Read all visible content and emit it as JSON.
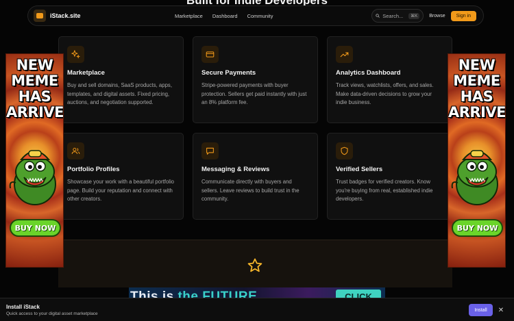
{
  "section": {
    "heading": "Built for Indie Developers"
  },
  "navbar": {
    "brand": "iStack.site",
    "links": [
      "Marketplace",
      "Dashboard",
      "Community"
    ],
    "search_placeholder": "Search...",
    "search_shortcut": "⌘K",
    "browse_label": "Browse",
    "signin_label": "Sign in"
  },
  "features": [
    {
      "icon": "sparkles-icon",
      "title": "Marketplace",
      "description": "Buy and sell domains, SaaS products, apps, templates, and digital assets. Fixed pricing, auctions, and negotiation supported."
    },
    {
      "icon": "credit-card-icon",
      "title": "Secure Payments",
      "description": "Stripe-powered payments with buyer protection. Sellers get paid instantly with just an 8% platform fee."
    },
    {
      "icon": "trending-up-icon",
      "title": "Analytics Dashboard",
      "description": "Track views, watchlists, offers, and sales. Make data-driven decisions to grow your indie business."
    },
    {
      "icon": "users-icon",
      "title": "Portfolio Profiles",
      "description": "Showcase your work with a beautiful portfolio page. Build your reputation and connect with other creators."
    },
    {
      "icon": "message-square-icon",
      "title": "Messaging & Reviews",
      "description": "Communicate directly with buyers and sellers. Leave reviews to build trust in the community."
    },
    {
      "icon": "shield-icon",
      "title": "Verified Sellers",
      "description": "Trust badges for verified creators. Know you're buying from real, established indie developers."
    }
  ],
  "side_ad": {
    "headline_lines": [
      "NEW",
      "MEME",
      "HAS",
      "ARRIVED!"
    ],
    "cta": "BUY NOW"
  },
  "bottom_banner": {
    "text_start": "This is ",
    "text_highlight": "the FUTURE",
    "cta": "CLICK"
  },
  "install_prompt": {
    "title": "Install iStack",
    "subtitle": "Quick access to your digital asset marketplace",
    "button_label": "Install",
    "close_symbol": "✕"
  },
  "colors": {
    "accent": "#f29a1a",
    "install_button": "#6a61e8",
    "background": "#050505"
  }
}
